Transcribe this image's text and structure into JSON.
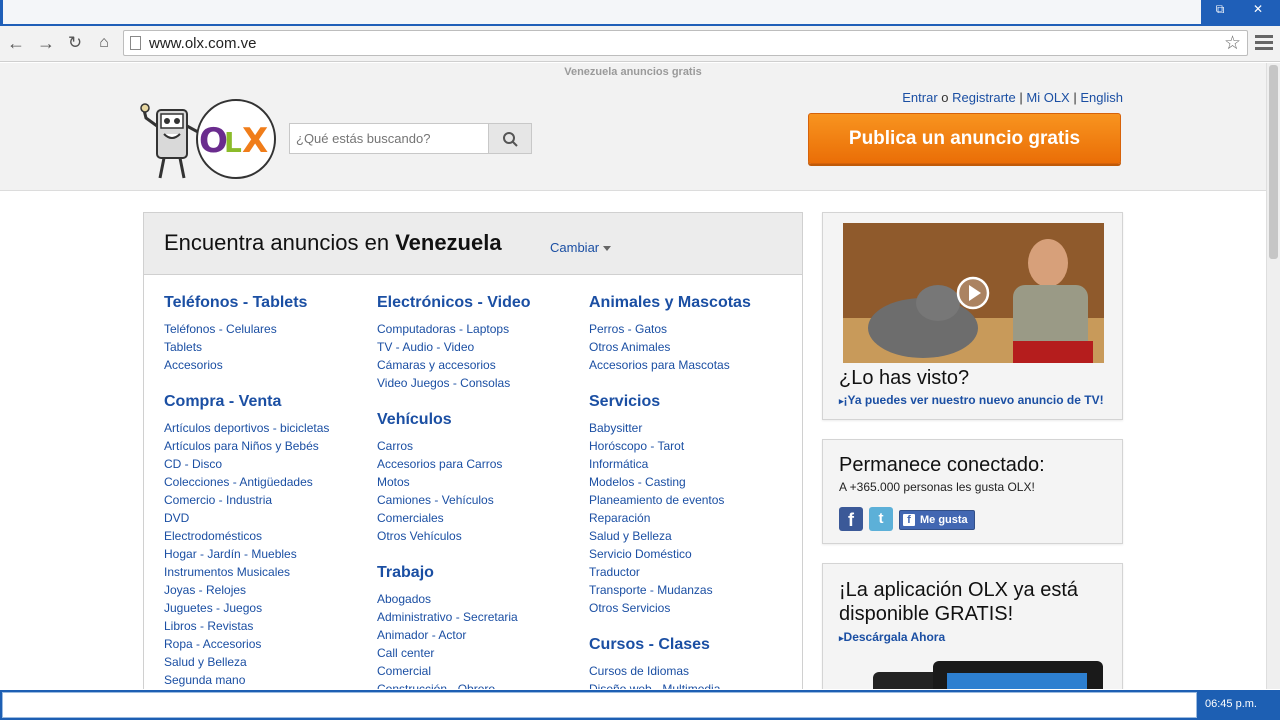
{
  "browser": {
    "url": "www.olx.com.ve"
  },
  "site": {
    "tagline": "Venezuela anuncios gratis",
    "search_placeholder": "¿Qué estás buscando?",
    "links": {
      "login": "Entrar",
      "or": "o",
      "register": "Registrarte",
      "sep": "|",
      "my_olx": "Mi OLX",
      "english": "English"
    },
    "publish_label": "Publica un anuncio gratis"
  },
  "panel": {
    "title_prefix": "Encuentra anuncios en",
    "title_location": "Venezuela",
    "change_label": "Cambiar"
  },
  "categories": {
    "col1": [
      {
        "title": "Teléfonos - Tablets",
        "items": [
          "Teléfonos - Celulares",
          "Tablets",
          "Accesorios"
        ]
      },
      {
        "title": "Compra - Venta",
        "items": [
          "Artículos deportivos - bicicletas",
          "Artículos para Niños y Bebés",
          "CD - Disco",
          "Colecciones - Antigüedades",
          "Comercio - Industria",
          "DVD",
          "Electrodomésticos",
          "Hogar - Jardín - Muebles",
          "Instrumentos Musicales",
          "Joyas - Relojes",
          "Juguetes - Juegos",
          "Libros - Revistas",
          "Ropa - Accesorios",
          "Salud y Belleza",
          "Segunda mano"
        ]
      }
    ],
    "col2": [
      {
        "title": "Electrónicos - Video",
        "items": [
          "Computadoras - Laptops",
          "TV - Audio - Video",
          "Cámaras y accesorios",
          "Video Juegos - Consolas"
        ]
      },
      {
        "title": "Vehículos",
        "items": [
          "Carros",
          "Accesorios para Carros",
          "Motos",
          "Camiones - Vehículos",
          "Comerciales",
          "Otros Vehículos"
        ]
      },
      {
        "title": "Trabajo",
        "items": [
          "Abogados",
          "Administrativo - Secretaria",
          "Animador - Actor",
          "Call center",
          "Comercial",
          "Construcción - Obrero"
        ]
      }
    ],
    "col3": [
      {
        "title": "Animales y Mascotas",
        "items": [
          "Perros - Gatos",
          "Otros Animales",
          "Accesorios para Mascotas"
        ]
      },
      {
        "title": "Servicios",
        "items": [
          "Babysitter",
          "Horóscopo - Tarot",
          "Informática",
          "Modelos - Casting",
          "Planeamiento de eventos",
          "Reparación",
          "Salud y Belleza",
          "Servicio Doméstico",
          "Traductor",
          "Transporte - Mudanzas",
          "Otros Servicios"
        ]
      },
      {
        "title": "Cursos - Clases",
        "items": [
          "Cursos de Idiomas",
          "Diseño web - Multimedia"
        ]
      }
    ]
  },
  "side": {
    "video_title": "¿Lo has visto?",
    "video_link": "¡Ya puedes ver nuestro nuevo anuncio de TV!",
    "social_title": "Permanece conectado:",
    "social_text": "A +365.000 personas les gusta OLX!",
    "like_label": "Me gusta",
    "app_title_line1": "¡La aplicación OLX ya está",
    "app_title_line2": "disponible GRATIS!",
    "app_link": "Descárgala Ahora"
  },
  "taskbar": {
    "time": "06:45 p.m."
  },
  "colors": {
    "link_blue": "#1b4fa3",
    "publish_orange": "#f08419",
    "taskbar_blue": "#1d5fb3"
  }
}
